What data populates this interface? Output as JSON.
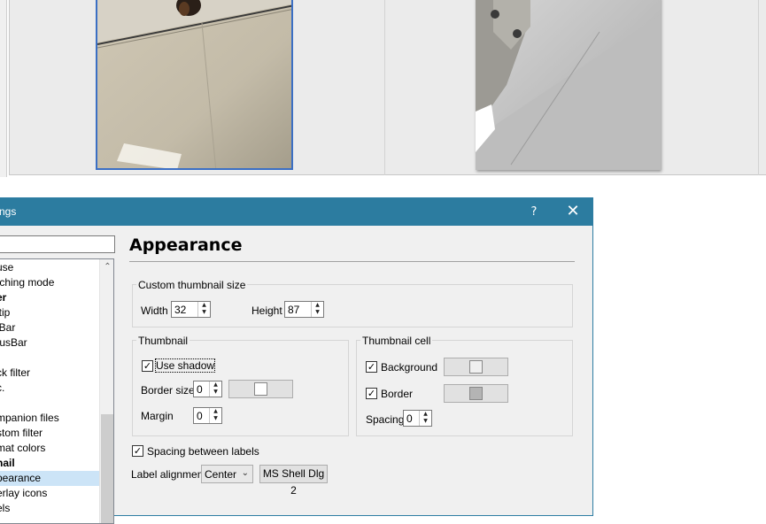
{
  "colors": {
    "titlebar": "#2c7ca0",
    "selection": "#cce4f7",
    "thumb_selection_border": "#3b6fc4"
  },
  "dialog": {
    "title": "ngs",
    "help_glyph": "?",
    "close_glyph": "✕",
    "search": {
      "value": ""
    },
    "tree": {
      "items": [
        {
          "label": "use",
          "bold": false,
          "selected": false
        },
        {
          "label": "tching mode",
          "bold": false,
          "selected": false
        },
        {
          "label": "er",
          "bold": true,
          "selected": false
        },
        {
          "label": "ltip",
          "bold": false,
          "selected": false
        },
        {
          "label": "lBar",
          "bold": false,
          "selected": false
        },
        {
          "label": "tusBar",
          "bold": false,
          "selected": false
        },
        {
          "label": "",
          "bold": false,
          "selected": false
        },
        {
          "label": "ck filter",
          "bold": false,
          "selected": false
        },
        {
          "label": "c.",
          "bold": false,
          "selected": false
        },
        {
          "label": "t",
          "bold": false,
          "selected": false
        },
        {
          "label": "mpanion files",
          "bold": false,
          "selected": false
        },
        {
          "label": "stom filter",
          "bold": false,
          "selected": false
        },
        {
          "label": "mat colors",
          "bold": false,
          "selected": false
        },
        {
          "label": "nail",
          "bold": true,
          "selected": false
        },
        {
          "label": "pearance",
          "bold": false,
          "selected": true
        },
        {
          "label": "erlay icons",
          "bold": false,
          "selected": false
        },
        {
          "label": "els",
          "bold": false,
          "selected": false
        }
      ],
      "scroll_up_glyph": "⌃"
    },
    "page": {
      "title": "Appearance",
      "custom_size": {
        "group_label": "Custom thumbnail size",
        "width_label": "Width",
        "width_value": "32",
        "height_label": "Height",
        "height_value": "87"
      },
      "thumbnail": {
        "group_label": "Thumbnail",
        "use_shadow_label": "Use shadow",
        "use_shadow_checked": true,
        "border_size_label": "Border size",
        "border_size_value": "0",
        "border_color": "#ffffff",
        "margin_label": "Margin",
        "margin_value": "0"
      },
      "thumbnail_cell": {
        "group_label": "Thumbnail cell",
        "background_label": "Background",
        "background_checked": true,
        "background_color": "#f0f0f0",
        "border_label": "Border",
        "border_checked": true,
        "border_color": "#b4b4b4",
        "spacing_label": "Spacing",
        "spacing_value": "0"
      },
      "spacing_between_labels": {
        "label": "Spacing between labels",
        "checked": true
      },
      "label_alignment": {
        "label": "Label alignment",
        "value": "Center",
        "font_button": "MS Shell Dlg 2"
      }
    }
  }
}
